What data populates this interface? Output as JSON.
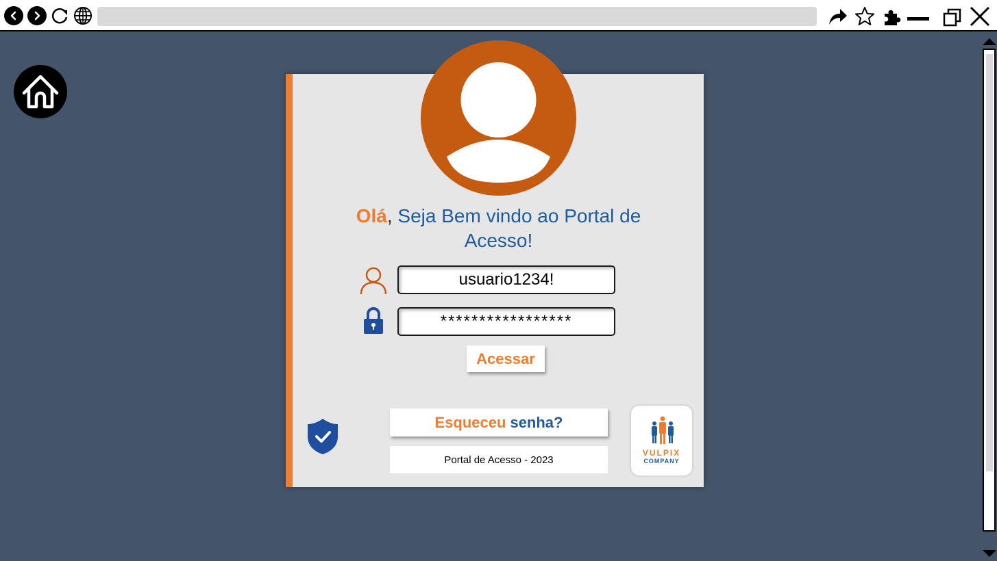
{
  "browser": {
    "icons": [
      "back-icon",
      "forward-icon",
      "reload-icon",
      "globe-icon",
      "share-icon",
      "star-icon",
      "extensions-icon",
      "minimize-icon",
      "restore-icon",
      "close-icon"
    ],
    "url": ""
  },
  "page": {
    "greeting_hi": "Olá",
    "greeting_comma": ",",
    "greeting_rest": " Seja Bem vindo ao Portal de Acesso!",
    "username_value": "usuario1234!",
    "password_value": "*****************",
    "login_button": "Acessar",
    "forgot_part1": "Esqueceu",
    "forgot_part2": "senha?",
    "footer_text": "Portal de Acesso - 2023",
    "logo_name": "VULPIX",
    "logo_sub": "COMPANY"
  },
  "colors": {
    "background": "#44546a",
    "accent_orange": "#ed7d31",
    "avatar": "#c55a11",
    "text_blue": "#1f5c99",
    "card": "#e6e6e6"
  }
}
